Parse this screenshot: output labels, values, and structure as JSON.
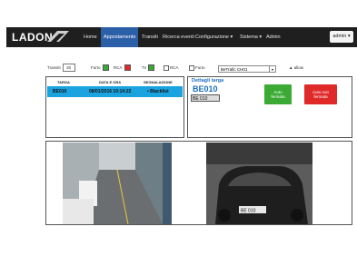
{
  "header": {
    "logo": "LADON",
    "nav": [
      {
        "label": "Home",
        "active": false
      },
      {
        "label": "Appostamento",
        "active": true
      },
      {
        "label": "Transiti",
        "active": false
      },
      {
        "label": "Ricerca eventi",
        "active": false
      },
      {
        "label": "Configurazione ▾",
        "active": false
      },
      {
        "label": "Sistema ▾",
        "active": false
      },
      {
        "label": "Admin",
        "active": false
      }
    ],
    "user": "admin ▾"
  },
  "controls": {
    "transiti_label": "Transiti",
    "transiti_value": "30",
    "furto_label": "Furto",
    "rca_label": "RCA",
    "tn_label": "Tn",
    "rca2_label": "RCA",
    "furto2_label": "Furto",
    "camera_select": "BeTrafic CH01",
    "allow_label": "▲ allow"
  },
  "table": {
    "headers": [
      "TARGA",
      "DATA E ORA",
      "SEGNALAZIONE"
    ],
    "rows": [
      {
        "targa": "BE010",
        "data": "08/01/2016 10:14:22",
        "segnalazione": "• Blacklist"
      }
    ]
  },
  "details": {
    "title": "Dettagli targa",
    "plate": "BE010",
    "plate_img": "BE 010",
    "btn_auto": "Auto\nfermata",
    "btn_auto_non": "Auto non\nfermata"
  },
  "colors": {
    "topbar": "#1f1f1f",
    "nav_active": "#2b5fa7",
    "row_selected": "#1aa3df",
    "furto": "#3aaa35",
    "rca": "#e02a2a",
    "tn": "#3aaa35"
  }
}
